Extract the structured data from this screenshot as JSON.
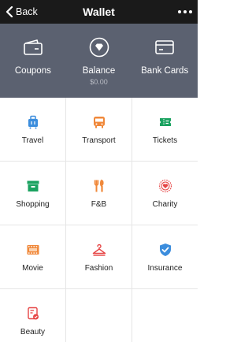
{
  "nav": {
    "back_label": "Back",
    "title": "Wallet"
  },
  "hero": {
    "items": [
      {
        "label": "Coupons",
        "sub": "",
        "icon": "wallet-icon"
      },
      {
        "label": "Balance",
        "sub": "$0.00",
        "icon": "diamond-coin-icon"
      },
      {
        "label": "Bank Cards",
        "sub": "",
        "icon": "bank-card-icon"
      }
    ]
  },
  "services": [
    {
      "label": "Travel",
      "icon": "suitcase-icon",
      "color": "#3b8ddd"
    },
    {
      "label": "Transport",
      "icon": "bus-icon",
      "color": "#f0883a"
    },
    {
      "label": "Tickets",
      "icon": "ticket-icon",
      "color": "#1aa260"
    },
    {
      "label": "Shopping",
      "icon": "box-icon",
      "color": "#1aa260"
    },
    {
      "label": "F&B",
      "icon": "utensils-icon",
      "color": "#f0883a"
    },
    {
      "label": "Charity",
      "icon": "heart-badge-icon",
      "color": "#e64545"
    },
    {
      "label": "Movie",
      "icon": "film-icon",
      "color": "#f0883a"
    },
    {
      "label": "Fashion",
      "icon": "hanger-icon",
      "color": "#e64545"
    },
    {
      "label": "Insurance",
      "icon": "shield-icon",
      "color": "#3b8ddd"
    },
    {
      "label": "Beauty",
      "icon": "cosmetics-icon",
      "color": "#e64545"
    }
  ]
}
